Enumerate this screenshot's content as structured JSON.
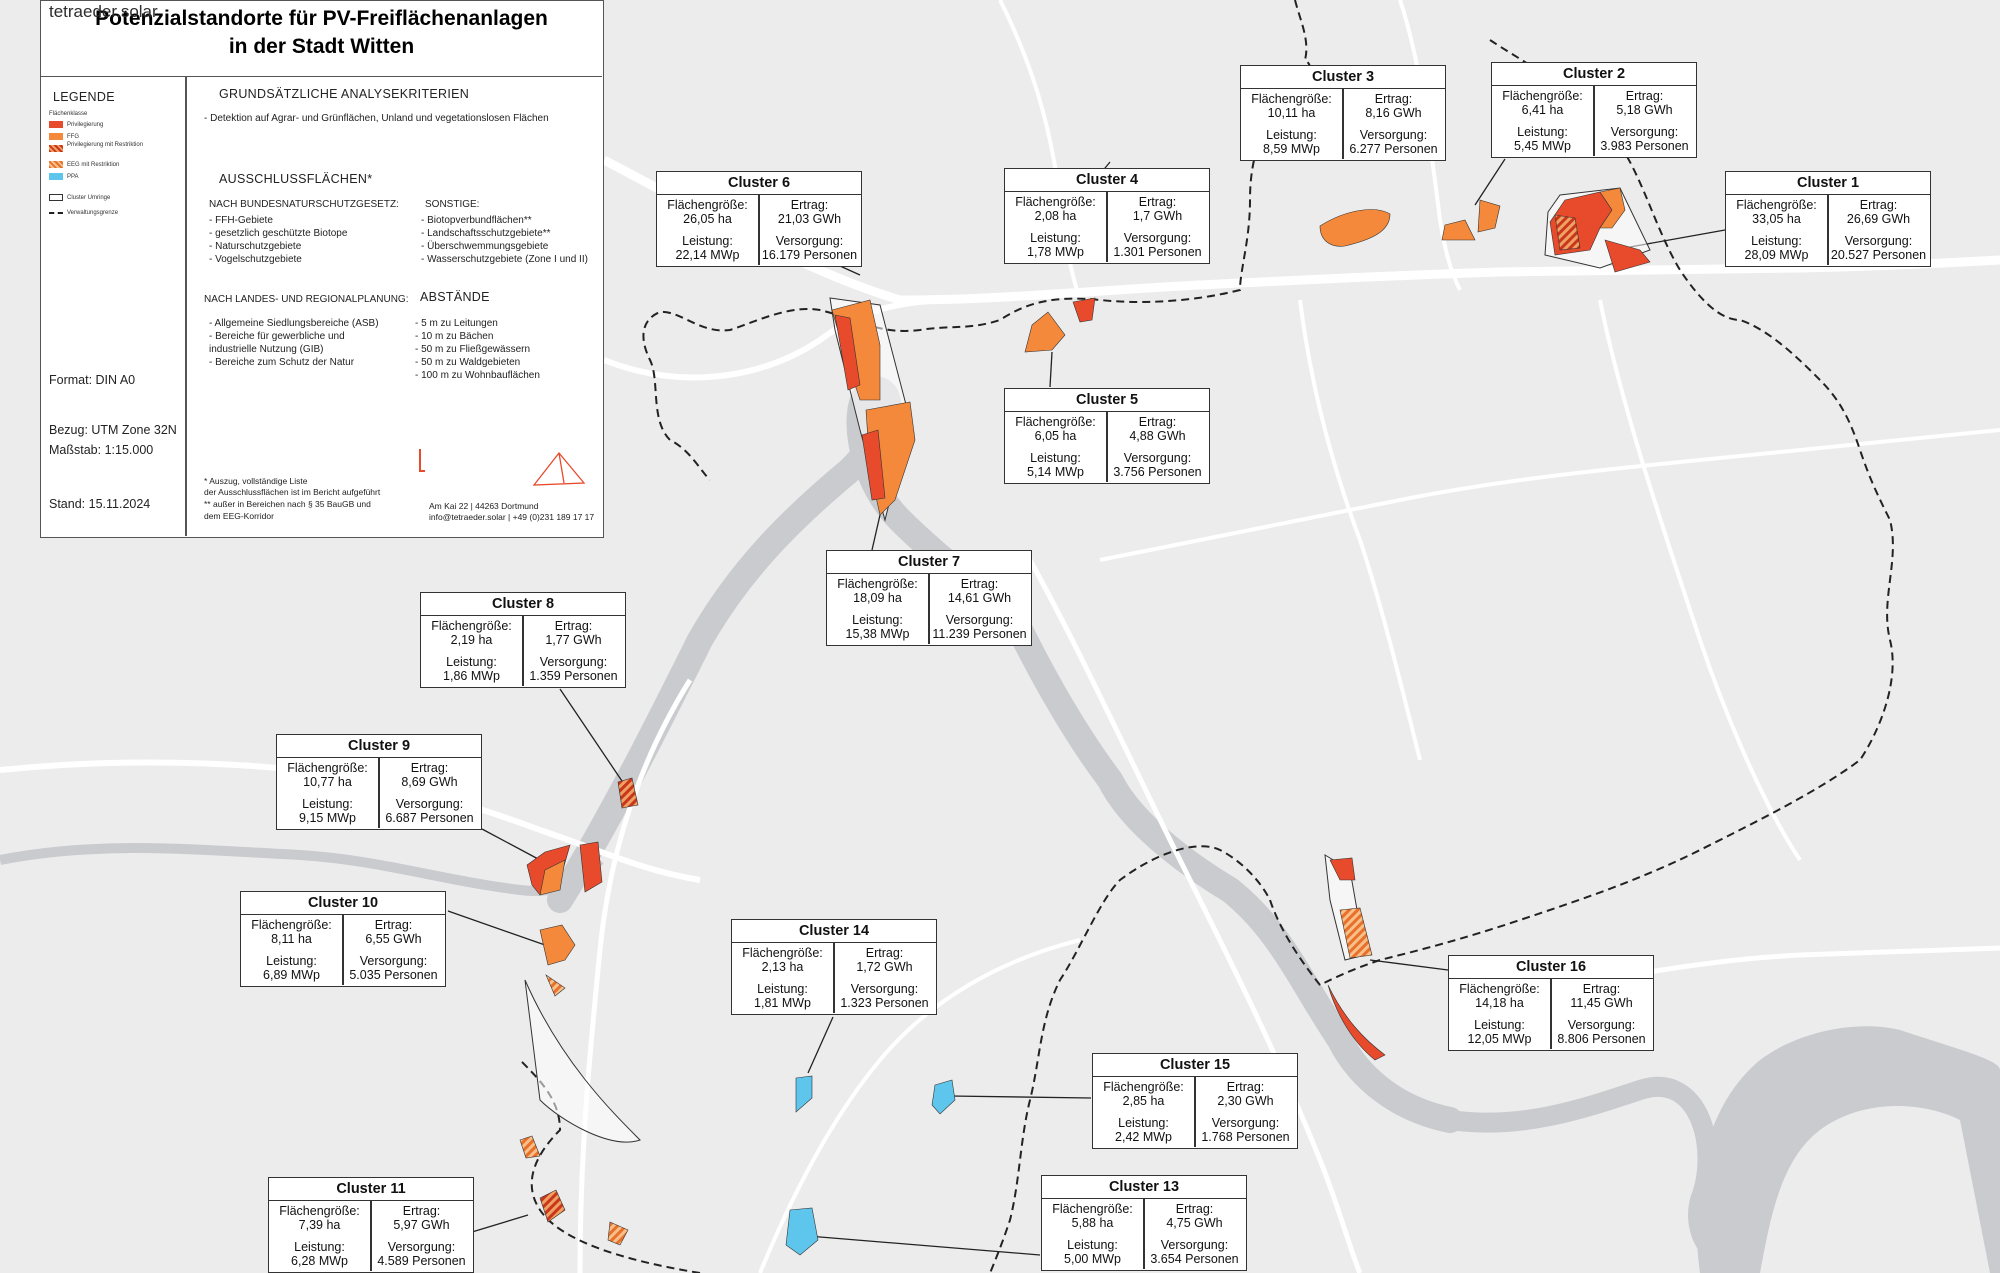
{
  "title": {
    "line1": "Potenzialstandorte für PV-Freiflächenanlagen",
    "line2": "in der Stadt Witten"
  },
  "legend": {
    "heading": "LEGENDE",
    "category_heading": "Flächenklasse",
    "items": [
      {
        "label": "Privilegierung",
        "color": "#e84a2c",
        "pattern": "solid"
      },
      {
        "label": "FFG",
        "color": "#f4893b",
        "pattern": "solid"
      },
      {
        "label": "Privilegierung mit Restriktion",
        "color": "#e84a2c",
        "pattern": "hatched"
      },
      {
        "label": "EEG mit Restriktion",
        "color": "#f4893b",
        "pattern": "hatched"
      },
      {
        "label": "PPA",
        "color": "#5ec6ec",
        "pattern": "solid"
      }
    ],
    "cluster_outline": "Cluster Umringe",
    "boundary": "Verwaltungsgrenze",
    "format": "Format: DIN A0",
    "reference": "Bezug: UTM Zone 32N",
    "scale": "Maßstab: 1:15.000",
    "date": "Stand: 15.11.2024"
  },
  "criteria": {
    "heading": "GRUNDSÄTZLICHE ANALYSEKRITERIEN",
    "detection": "- Detektion auf Agrar- und Grünflächen, Unland und vegetationslosen Flächen",
    "exclusion_heading": "AUSSCHLUSSFLÄCHEN*",
    "nature_heading": "NACH BUNDESNATURSCHUTZGESETZ:",
    "nature_items": [
      "- FFH-Gebiete",
      "- gesetzlich geschützte Biotope",
      "- Naturschutzgebiete",
      "- Vogelschutzgebiete"
    ],
    "other_heading": "SONSTIGE:",
    "other_items": [
      "- Biotopverbundflächen**",
      "- Landschaftsschutzgebiete**",
      "- Überschwemmungsgebiete",
      "- Wasserschutzgebiete (Zone I und II)"
    ],
    "planning_heading": "NACH LANDES- UND REGIONALPLANUNG:",
    "planning_items": [
      "- Allgemeine Siedlungsbereiche (ASB)",
      "- Bereiche für gewerbliche und",
      "  industrielle Nutzung (GIB)",
      "- Bereiche zum Schutz der Natur"
    ],
    "distances_heading": "ABSTÄNDE",
    "distances_items": [
      "- 5 m zu Leitungen",
      "- 10 m zu Bächen",
      "- 50 m zu Fließgewässern",
      "- 50 m zu Waldgebieten",
      "- 100 m zu Wohnbauflächen"
    ],
    "footnote1a": "*  Auszug, vollständige Liste",
    "footnote1b": "   der Ausschlussflächen ist im Bericht aufgeführt",
    "footnote2a": "** außer in Bereichen nach § 35 BauGB und",
    "footnote2b": "   dem EEG-Korridor"
  },
  "company": {
    "name": "tetraeder.solar",
    "address": "Am Kai 22 | 44263 Dortmund",
    "contact": "info@tetraeder.solar | +49 (0)231 189 17 17"
  },
  "clusters": [
    {
      "name": "Cluster 1",
      "area_label": "Flächengröße:",
      "area": "33,05 ha",
      "yield_label": "Ertrag:",
      "yield": "26,69 GWh",
      "power_label": "Leistung:",
      "power": "28,09 MWp",
      "supply_label": "Versorgung:",
      "supply": "20.527 Personen"
    },
    {
      "name": "Cluster 2",
      "area_label": "Flächengröße:",
      "area": "6,41 ha",
      "yield_label": "Ertrag:",
      "yield": "5,18 GWh",
      "power_label": "Leistung:",
      "power": "5,45 MWp",
      "supply_label": "Versorgung:",
      "supply": "3.983 Personen"
    },
    {
      "name": "Cluster 3",
      "area_label": "Flächengröße:",
      "area": "10,11 ha",
      "yield_label": "Ertrag:",
      "yield": "8,16 GWh",
      "power_label": "Leistung:",
      "power": "8,59 MWp",
      "supply_label": "Versorgung:",
      "supply": "6.277 Personen"
    },
    {
      "name": "Cluster 4",
      "area_label": "Flächengröße:",
      "area": "2,08 ha",
      "yield_label": "Ertrag:",
      "yield": "1,7 GWh",
      "power_label": "Leistung:",
      "power": "1,78 MWp",
      "supply_label": "Versorgung:",
      "supply": "1.301 Personen"
    },
    {
      "name": "Cluster 5",
      "area_label": "Flächengröße:",
      "area": "6,05 ha",
      "yield_label": "Ertrag:",
      "yield": "4,88 GWh",
      "power_label": "Leistung:",
      "power": "5,14 MWp",
      "supply_label": "Versorgung:",
      "supply": "3.756 Personen"
    },
    {
      "name": "Cluster 6",
      "area_label": "Flächengröße:",
      "area": "26,05 ha",
      "yield_label": "Ertrag:",
      "yield": "21,03 GWh",
      "power_label": "Leistung:",
      "power": "22,14 MWp",
      "supply_label": "Versorgung:",
      "supply": "16.179 Personen"
    },
    {
      "name": "Cluster 7",
      "area_label": "Flächengröße:",
      "area": "18,09 ha",
      "yield_label": "Ertrag:",
      "yield": "14,61 GWh",
      "power_label": "Leistung:",
      "power": "15,38 MWp",
      "supply_label": "Versorgung:",
      "supply": "11.239 Personen"
    },
    {
      "name": "Cluster 8",
      "area_label": "Flächengröße:",
      "area": "2,19 ha",
      "yield_label": "Ertrag:",
      "yield": "1,77 GWh",
      "power_label": "Leistung:",
      "power": "1,86 MWp",
      "supply_label": "Versorgung:",
      "supply": "1.359 Personen"
    },
    {
      "name": "Cluster 9",
      "area_label": "Flächengröße:",
      "area": "10,77 ha",
      "yield_label": "Ertrag:",
      "yield": "8,69 GWh",
      "power_label": "Leistung:",
      "power": "9,15 MWp",
      "supply_label": "Versorgung:",
      "supply": "6.687 Personen"
    },
    {
      "name": "Cluster 10",
      "area_label": "Flächengröße:",
      "area": "8,11 ha",
      "yield_label": "Ertrag:",
      "yield": "6,55 GWh",
      "power_label": "Leistung:",
      "power": "6,89 MWp",
      "supply_label": "Versorgung:",
      "supply": "5.035 Personen"
    },
    {
      "name": "Cluster 11",
      "area_label": "Flächengröße:",
      "area": "7,39 ha",
      "yield_label": "Ertrag:",
      "yield": "5,97 GWh",
      "power_label": "Leistung:",
      "power": "6,28 MWp",
      "supply_label": "Versorgung:",
      "supply": "4.589 Personen"
    },
    {
      "name": "Cluster 13",
      "area_label": "Flächengröße:",
      "area": "5,88 ha",
      "yield_label": "Ertrag:",
      "yield": "4,75 GWh",
      "power_label": "Leistung:",
      "power": "5,00 MWp",
      "supply_label": "Versorgung:",
      "supply": "3.654 Personen"
    },
    {
      "name": "Cluster 14",
      "area_label": "Flächengröße:",
      "area": "2,13 ha",
      "yield_label": "Ertrag:",
      "yield": "1,72 GWh",
      "power_label": "Leistung:",
      "power": "1,81 MWp",
      "supply_label": "Versorgung:",
      "supply": "1.323 Personen"
    },
    {
      "name": "Cluster 15",
      "area_label": "Flächengröße:",
      "area": "2,85 ha",
      "yield_label": "Ertrag:",
      "yield": "2,30 GWh",
      "power_label": "Leistung:",
      "power": "2,42 MWp",
      "supply_label": "Versorgung:",
      "supply": "1.768 Personen"
    },
    {
      "name": "Cluster 16",
      "area_label": "Flächengröße:",
      "area": "14,18 ha",
      "yield_label": "Ertrag:",
      "yield": "11,45 GWh",
      "power_label": "Leistung:",
      "power": "12,05 MWp",
      "supply_label": "Versorgung:",
      "supply": "8.806 Personen"
    }
  ],
  "colors": {
    "map_background": "#ececec",
    "road": "#ffffff",
    "water": "#c9cbce",
    "privilegierung": "#e84a2c",
    "ffg": "#f4893b",
    "ppa": "#5ec6ec",
    "boundary": "#222222"
  }
}
